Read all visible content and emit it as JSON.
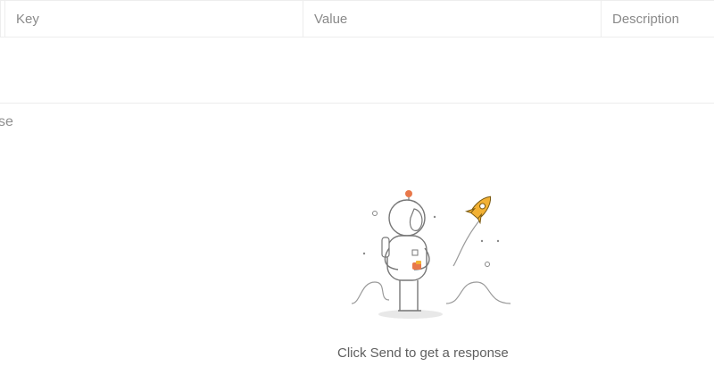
{
  "params_table": {
    "columns": [
      {
        "label": "Key"
      },
      {
        "label": "Value"
      },
      {
        "label": "Description"
      }
    ]
  },
  "response": {
    "section_label_partial": "se",
    "empty_state_message": "Click Send to get a response",
    "illustration_icon": "astronaut-rocket-illustration",
    "accent_color": "#f2b134"
  }
}
